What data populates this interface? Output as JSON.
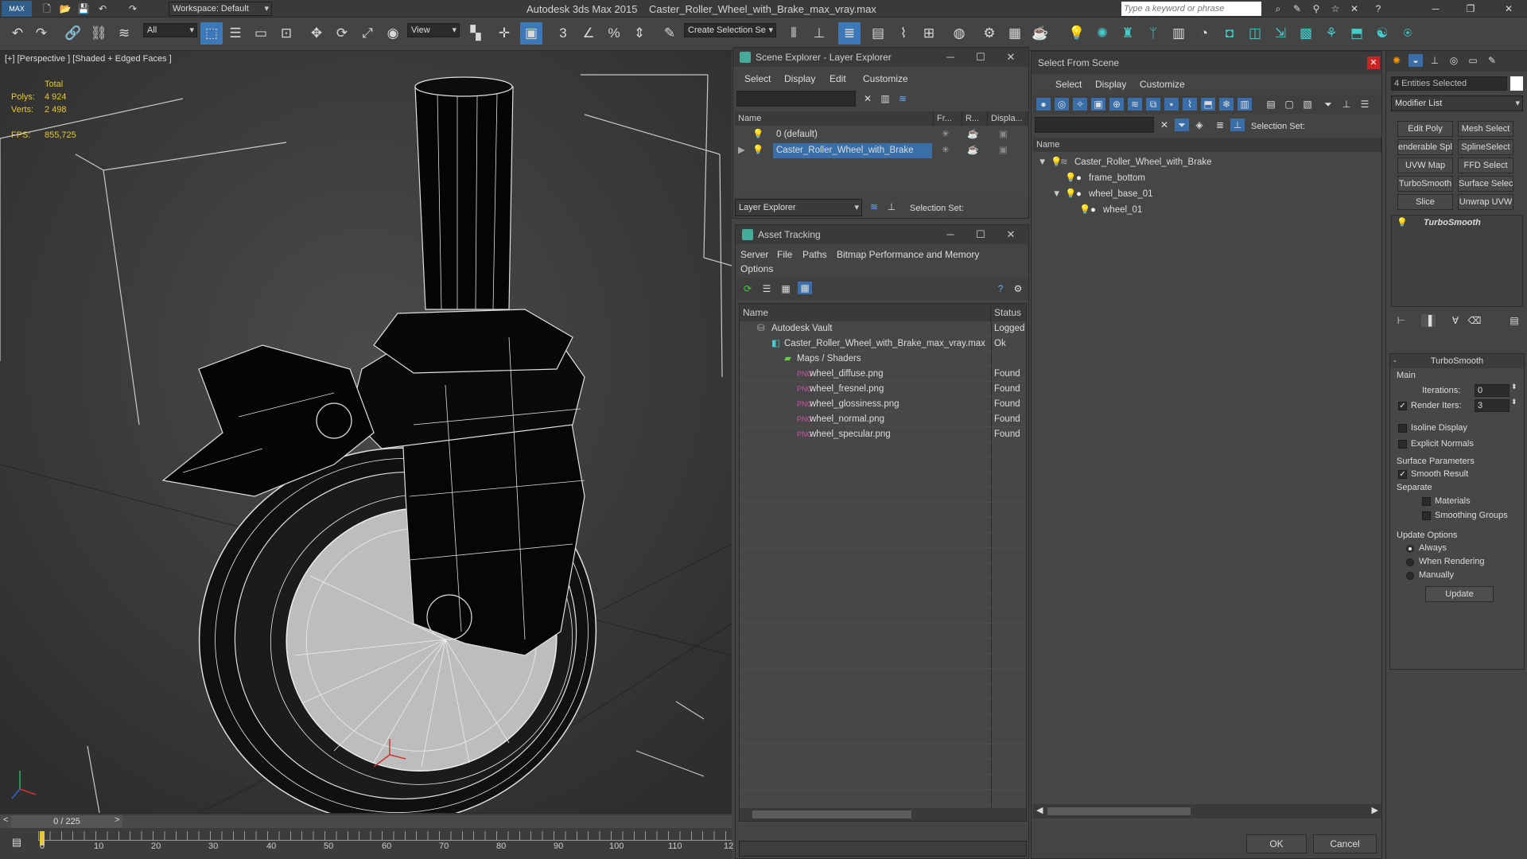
{
  "app": {
    "name": "Autodesk 3ds Max 2015",
    "file": "Caster_Roller_Wheel_with_Brake_max_vray.max",
    "workspace": "Workspace: Default",
    "search_placeholder": "Type a keyword or phrase"
  },
  "toolbar": {
    "filter": "All",
    "view": "View",
    "selection_set": "Create Selection Se"
  },
  "viewport": {
    "label": "[+] [Perspective ] [Shaded + Edged Faces ]",
    "stats_total": "Total",
    "polys_label": "Polys:",
    "polys": "4 924",
    "verts_label": "Verts:",
    "verts": "2 498",
    "fps_label": "FPS:",
    "fps": "855,725"
  },
  "scene_explorer": {
    "title": "Scene Explorer - Layer Explorer",
    "menu": [
      "Select",
      "Display",
      "Edit",
      "Customize"
    ],
    "col_name": "Name",
    "col_fr": "Fr...",
    "col_r": "R...",
    "col_disp": "Displa...",
    "rows": [
      "0 (default)",
      "Caster_Roller_Wheel_with_Brake"
    ],
    "footer_dropdown": "Layer Explorer",
    "footer_selset": "Selection Set:"
  },
  "asset_tracking": {
    "title": "Asset Tracking",
    "menu": [
      "Server",
      "File",
      "Paths",
      "Bitmap Performance and Memory",
      "Options"
    ],
    "col_name": "Name",
    "col_status": "Status",
    "rows": [
      {
        "name": "Autodesk Vault",
        "status": "Logged"
      },
      {
        "name": "Caster_Roller_Wheel_with_Brake_max_vray.max",
        "status": "Ok"
      },
      {
        "name": "Maps / Shaders",
        "status": ""
      },
      {
        "name": "wheel_diffuse.png",
        "status": "Found"
      },
      {
        "name": "wheel_fresnel.png",
        "status": "Found"
      },
      {
        "name": "wheel_glossiness.png",
        "status": "Found"
      },
      {
        "name": "wheel_normal.png",
        "status": "Found"
      },
      {
        "name": "wheel_specular.png",
        "status": "Found"
      }
    ]
  },
  "select_from_scene": {
    "title": "Select From Scene",
    "menu": [
      "Select",
      "Display",
      "Customize"
    ],
    "selset": "Selection Set:",
    "col_name": "Name",
    "tree": [
      "Caster_Roller_Wheel_with_Brake",
      "frame_bottom",
      "wheel_base_01",
      "wheel_01"
    ],
    "ok": "OK",
    "cancel": "Cancel"
  },
  "command_panel": {
    "selected": "4 Entities Selected",
    "modifier_list": "Modifier List",
    "buttons": [
      "Edit Poly",
      "Mesh Select",
      "enderable Splir",
      "SplineSelect",
      "UVW Map",
      "FFD Select",
      "TurboSmooth",
      "Surface Select",
      "Slice",
      "Unwrap UVW"
    ],
    "stack_item": "TurboSmooth",
    "rollout": {
      "title": "TurboSmooth",
      "main": "Main",
      "iterations_label": "Iterations:",
      "iterations": "0",
      "render_iters_label": "Render Iters:",
      "render_iters": "3",
      "isoline": "Isoline Display",
      "explicit": "Explicit Normals",
      "surface": "Surface Parameters",
      "smooth": "Smooth Result",
      "separate": "Separate",
      "materials": "Materials",
      "smoothing": "Smoothing Groups",
      "update_opts": "Update Options",
      "always": "Always",
      "when_rendering": "When Rendering",
      "manually": "Manually",
      "update": "Update"
    }
  },
  "timeline": {
    "frame": "0 / 225",
    "ticks": [
      "0",
      "10",
      "20",
      "30",
      "40",
      "50",
      "60",
      "70",
      "80",
      "90",
      "100",
      "110",
      "12"
    ]
  }
}
